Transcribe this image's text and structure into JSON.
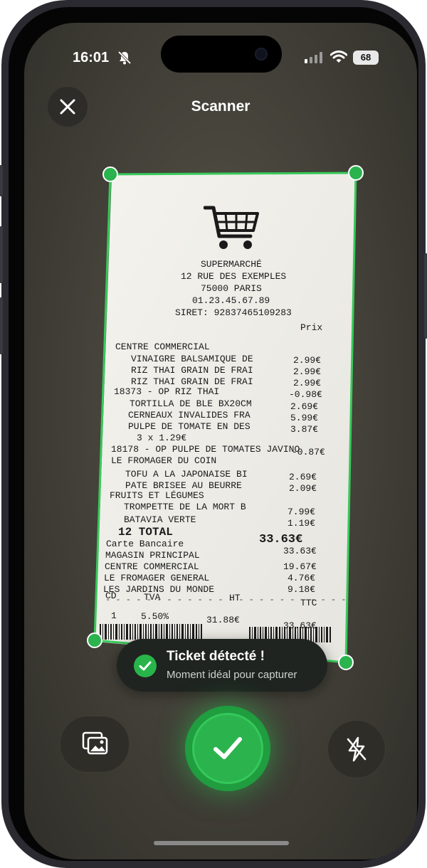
{
  "status_bar": {
    "time": "16:01",
    "battery": "68",
    "icons": [
      "bell-slash-icon",
      "signal-icon",
      "wifi-icon",
      "battery-icon"
    ]
  },
  "header": {
    "title": "Scanner",
    "close_icon": "close-icon"
  },
  "receipt": {
    "store_name": "SUPERMARCHÉ",
    "address_line": "12 RUE DES EXEMPLES",
    "city": "75000 PARIS",
    "phone": "01.23.45.67.89",
    "siret": "SIRET: 92837465109283",
    "price_header": "Prix",
    "lines": [
      {
        "label": "CENTRE COMMERCIAL",
        "price": ""
      },
      {
        "label": "VINAIGRE BALSAMIQUE DE",
        "price": "2.99€"
      },
      {
        "label": "RIZ THAI GRAIN DE FRAI",
        "price": "2.99€"
      },
      {
        "label": "RIZ THAI GRAIN DE FRAI",
        "price": "2.99€"
      },
      {
        "label": "18373 - OP RIZ THAI",
        "price": "-0.98€"
      },
      {
        "label": "TORTILLA DE BLE BX20CM",
        "price": "2.69€"
      },
      {
        "label": "CERNEAUX INVALIDES FRA",
        "price": "5.99€"
      },
      {
        "label": "PULPE DE TOMATE EN DES",
        "price": "3.87€"
      },
      {
        "label": "3 x 1.29€",
        "price": ""
      },
      {
        "label": "18178 - OP PULPE DE TOMATES JAVINO",
        "price": "-0.87€"
      },
      {
        "label": "LE FROMAGER DU COIN",
        "price": ""
      },
      {
        "label": "TOFU A LA JAPONAISE BI",
        "price": "2.69€"
      },
      {
        "label": "PATE BRISEE AU BEURRE",
        "price": "2.09€"
      },
      {
        "label": "FRUITS ET LÉGUMES",
        "price": ""
      },
      {
        "label": "TROMPETTE DE LA MORT B",
        "price": "7.99€"
      },
      {
        "label": "BATAVIA VERTE",
        "price": "1.19€"
      }
    ],
    "total_label": "12 TOTAL",
    "total_value": "33.63€",
    "payment": "Carte Bancaire",
    "breakdown": [
      {
        "label": "MAGASIN PRINCIPAL",
        "value": "33.63€"
      },
      {
        "label": "CENTRE COMMERCIAL",
        "value": "19.67€"
      },
      {
        "label": "LE FROMAGER GENERAL",
        "value": "4.76€"
      },
      {
        "label": "LES JARDINS DU MONDE",
        "value": "9.18€"
      }
    ],
    "tax_headers": [
      "CD",
      "TVA",
      "HT",
      "TTC"
    ],
    "tax_row": [
      "1",
      "5.50%",
      "31.88€",
      "33.63€"
    ]
  },
  "toast": {
    "title": "Ticket détecté !",
    "subtitle": "Moment idéal pour capturer"
  },
  "controls": {
    "gallery_icon": "gallery-icon",
    "capture_icon": "checkmark-icon",
    "flash_icon": "flash-off-icon"
  },
  "colors": {
    "accent_green": "#2bb34e",
    "detect_green": "#38c95a"
  }
}
